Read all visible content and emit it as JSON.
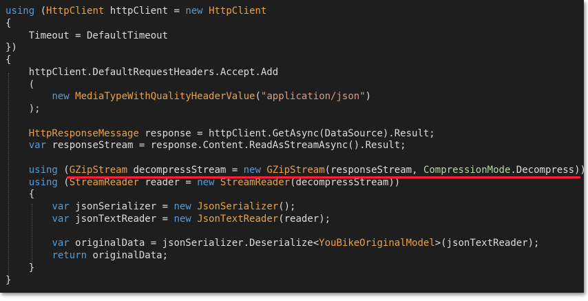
{
  "code": {
    "lines": [
      {
        "tokens": [
          {
            "t": "using",
            "k": "keyword"
          },
          {
            "t": " (",
            "k": "plain"
          },
          {
            "t": "HttpClient",
            "k": "type"
          },
          {
            "t": " httpClient = ",
            "k": "plain"
          },
          {
            "t": "new",
            "k": "keyword"
          },
          {
            "t": " ",
            "k": "plain"
          },
          {
            "t": "HttpClient",
            "k": "type"
          }
        ]
      },
      {
        "tokens": [
          {
            "t": "{",
            "k": "plain"
          }
        ]
      },
      {
        "tokens": [
          {
            "t": "    Timeout = DefaultTimeout",
            "k": "plain"
          }
        ]
      },
      {
        "tokens": [
          {
            "t": "})",
            "k": "plain"
          }
        ]
      },
      {
        "tokens": [
          {
            "t": "{",
            "k": "plain"
          }
        ]
      },
      {
        "tokens": [
          {
            "t": "    httpClient.DefaultRequestHeaders.Accept.Add",
            "k": "plain"
          }
        ]
      },
      {
        "tokens": [
          {
            "t": "    (",
            "k": "plain"
          }
        ]
      },
      {
        "tokens": [
          {
            "t": "        ",
            "k": "plain"
          },
          {
            "t": "new",
            "k": "keyword"
          },
          {
            "t": " ",
            "k": "plain"
          },
          {
            "t": "MediaTypeWithQualityHeaderValue",
            "k": "type"
          },
          {
            "t": "(",
            "k": "plain"
          },
          {
            "t": "\"application/json\"",
            "k": "string"
          },
          {
            "t": ")",
            "k": "plain"
          }
        ]
      },
      {
        "tokens": [
          {
            "t": "    );",
            "k": "plain"
          }
        ]
      },
      {
        "tokens": []
      },
      {
        "tokens": [
          {
            "t": "    ",
            "k": "plain"
          },
          {
            "t": "HttpResponseMessage",
            "k": "type"
          },
          {
            "t": " response = httpClient.GetAsync(DataSource).Result;",
            "k": "plain"
          }
        ]
      },
      {
        "tokens": [
          {
            "t": "    ",
            "k": "plain"
          },
          {
            "t": "var",
            "k": "keyword"
          },
          {
            "t": " responseStream = response.Content.ReadAsStreamAsync().Result;",
            "k": "plain"
          }
        ]
      },
      {
        "tokens": []
      },
      {
        "tokens": [
          {
            "t": "    ",
            "k": "plain"
          },
          {
            "t": "using",
            "k": "keyword"
          },
          {
            "t": " (",
            "k": "plain"
          },
          {
            "t": "GZipStream",
            "k": "type"
          },
          {
            "t": " decompressStream = ",
            "k": "plain"
          },
          {
            "t": "new",
            "k": "keyword"
          },
          {
            "t": " ",
            "k": "plain"
          },
          {
            "t": "GZipStream",
            "k": "type"
          },
          {
            "t": "(responseStream, ",
            "k": "plain"
          },
          {
            "t": "CompressionMode",
            "k": "enum"
          },
          {
            "t": ".Decompress))",
            "k": "plain"
          }
        ]
      },
      {
        "tokens": [
          {
            "t": "    ",
            "k": "plain"
          },
          {
            "t": "using",
            "k": "keyword"
          },
          {
            "t": " (",
            "k": "plain"
          },
          {
            "t": "StreamReader",
            "k": "type"
          },
          {
            "t": " reader = ",
            "k": "plain"
          },
          {
            "t": "new",
            "k": "keyword"
          },
          {
            "t": " ",
            "k": "plain"
          },
          {
            "t": "StreamReader",
            "k": "type"
          },
          {
            "t": "(decompressStream))",
            "k": "plain"
          }
        ]
      },
      {
        "tokens": [
          {
            "t": "    {",
            "k": "plain"
          }
        ]
      },
      {
        "tokens": [
          {
            "t": "        ",
            "k": "plain"
          },
          {
            "t": "var",
            "k": "keyword"
          },
          {
            "t": " jsonSerializer = ",
            "k": "plain"
          },
          {
            "t": "new",
            "k": "keyword"
          },
          {
            "t": " ",
            "k": "plain"
          },
          {
            "t": "JsonSerializer",
            "k": "type"
          },
          {
            "t": "();",
            "k": "plain"
          }
        ]
      },
      {
        "tokens": [
          {
            "t": "        ",
            "k": "plain"
          },
          {
            "t": "var",
            "k": "keyword"
          },
          {
            "t": " jsonTextReader = ",
            "k": "plain"
          },
          {
            "t": "new",
            "k": "keyword"
          },
          {
            "t": " ",
            "k": "plain"
          },
          {
            "t": "JsonTextReader",
            "k": "type"
          },
          {
            "t": "(reader);",
            "k": "plain"
          }
        ]
      },
      {
        "tokens": []
      },
      {
        "tokens": [
          {
            "t": "        ",
            "k": "plain"
          },
          {
            "t": "var",
            "k": "keyword"
          },
          {
            "t": " originalData = jsonSerializer.Deserialize<",
            "k": "plain"
          },
          {
            "t": "YouBikeOriginalModel",
            "k": "type"
          },
          {
            "t": ">(jsonTextReader);",
            "k": "plain"
          }
        ]
      },
      {
        "tokens": [
          {
            "t": "        ",
            "k": "plain"
          },
          {
            "t": "return",
            "k": "keyword"
          },
          {
            "t": " originalData;",
            "k": "plain"
          }
        ]
      },
      {
        "tokens": [
          {
            "t": "    }",
            "k": "plain"
          }
        ]
      },
      {
        "tokens": [
          {
            "t": "}",
            "k": "plain"
          }
        ]
      }
    ]
  },
  "colors": {
    "background": "#1e1e1e",
    "keyword": "#569cd6",
    "type": "#e8a24a",
    "enum": "#b8d7a3",
    "string": "#d69d85",
    "plain": "#dcdcdc",
    "highlight_underline": "#ff1f3a"
  }
}
